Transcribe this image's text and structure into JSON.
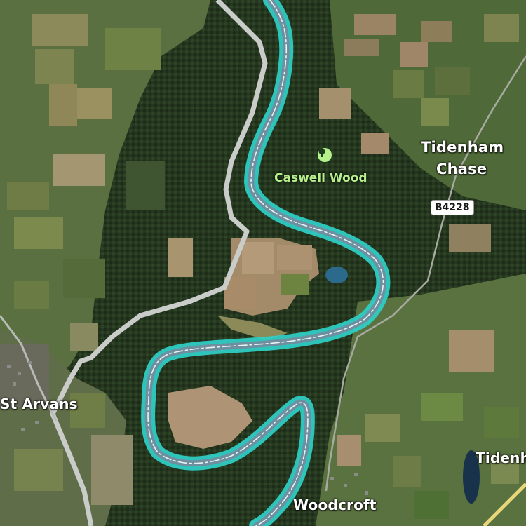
{
  "map": {
    "type": "satellite",
    "colors": {
      "river_highlight": "#2fd0c8",
      "river_water": "#6f8fa0",
      "road": "#c8ccc8",
      "highway": "#e8d67a",
      "poi_green": "#b6f08a",
      "forest": "#24361f"
    }
  },
  "places": {
    "tidenham_chase_line1": "Tidenham",
    "tidenham_chase_line2": "Chase",
    "st_arvans": "St Arvans",
    "woodcroft": "Woodcroft",
    "tidenham_partial": "Tidenh"
  },
  "poi": {
    "caswell_wood": "Caswell Wood",
    "icon": "tree-icon"
  },
  "roads": {
    "b4228": "B4228"
  }
}
